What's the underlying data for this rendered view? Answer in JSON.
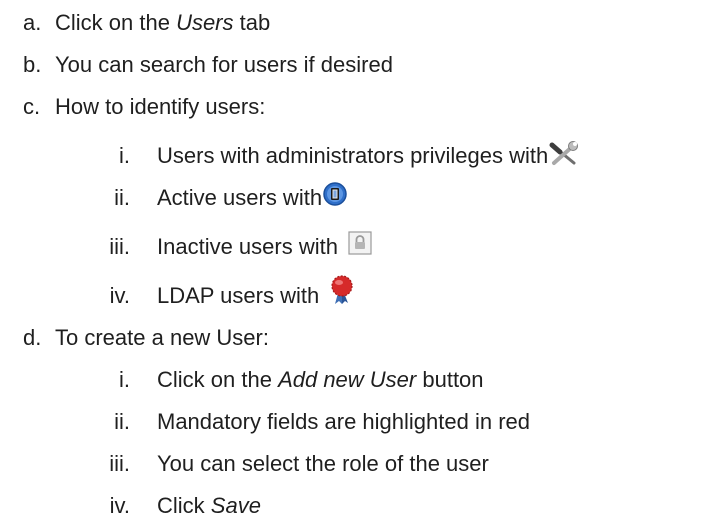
{
  "list": {
    "a": {
      "marker": "a.",
      "pre": "Click on the ",
      "em": "Users",
      "post": " tab"
    },
    "b": {
      "marker": "b.",
      "text": "You can search for users if desired"
    },
    "c": {
      "marker": "c.",
      "text": "How to identify users:",
      "items": [
        {
          "marker": "i.",
          "text": "Users with administrators privileges with",
          "icon": "wrench-screwdriver-icon"
        },
        {
          "marker": "ii.",
          "text": "Active users with",
          "icon": "active-user-icon"
        },
        {
          "marker": "iii.",
          "text": "Inactive users with ",
          "icon": "lock-icon"
        },
        {
          "marker": "iv.",
          "text": "LDAP users with ",
          "icon": "ldap-seal-icon"
        }
      ]
    },
    "d": {
      "marker": "d.",
      "text": "To create a new User:",
      "items": [
        {
          "marker": "i.",
          "pre": "Click on the ",
          "em": "Add new User",
          "post": " button"
        },
        {
          "marker": "ii.",
          "text": "Mandatory fields are highlighted in red"
        },
        {
          "marker": "iii.",
          "text": "You can select the role of the user"
        },
        {
          "marker": "iv.",
          "pre": "Click ",
          "em": "Save",
          "post": ""
        }
      ]
    }
  },
  "colors": {
    "text": "#1f1f1f",
    "active_icon_blue": "#2f6fc9",
    "ldap_red": "#d62a2a",
    "lock_gray": "#9a9a9a"
  }
}
